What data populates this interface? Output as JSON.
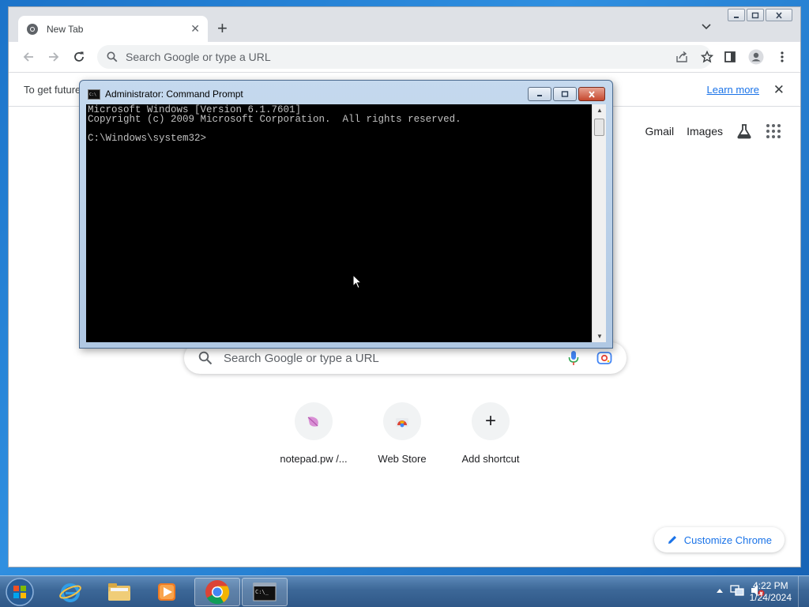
{
  "chrome": {
    "tab_title": "New Tab",
    "omnibox_placeholder": "Search Google or type a URL",
    "infobar_text": "To get future",
    "infobar_link": "Learn more",
    "ntp": {
      "gmail": "Gmail",
      "images": "Images",
      "search_placeholder": "Search Google or type a URL",
      "shortcuts": [
        {
          "label": "notepad.pw /...",
          "icon": "notepad-icon"
        },
        {
          "label": "Web Store",
          "icon": "web-store-icon"
        },
        {
          "label": "Add shortcut",
          "icon": "plus-icon"
        }
      ],
      "customize_label": "Customize Chrome"
    }
  },
  "cmd": {
    "title": "Administrator: Command Prompt",
    "output": "Microsoft Windows [Version 6.1.7601]\nCopyright (c) 2009 Microsoft Corporation.  All rights reserved.\n\nC:\\Windows\\system32>"
  },
  "taskbar": {
    "apps": [
      "internet-explorer-icon",
      "explorer-folder-icon",
      "media-player-icon",
      "chrome-icon",
      "cmd-icon"
    ],
    "active_apps": [
      "chrome-icon",
      "cmd-icon"
    ],
    "clock_time": "4:22 PM",
    "clock_date": "1/24/2024"
  },
  "colors": {
    "chrome_accent": "#1a73e8",
    "desktop_blue": "#1b73c9",
    "cmd_text": "#c0c0c0"
  }
}
